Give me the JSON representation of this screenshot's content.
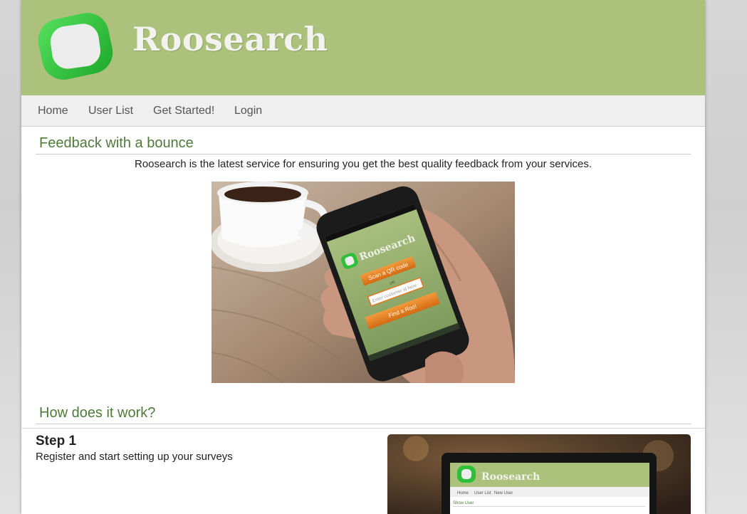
{
  "brand": {
    "name": "Roosearch"
  },
  "nav": [
    {
      "label": "Home"
    },
    {
      "label": "User List"
    },
    {
      "label": "Get Started!"
    },
    {
      "label": "Login"
    }
  ],
  "hero": {
    "title": "Feedback with a bounce",
    "intro": "Roosearch is the latest service for ensuring you get the best quality feedback from your services.",
    "phone": {
      "app_name": "Roosearch",
      "scan_button": "Scan a QR code",
      "or_text": "OR",
      "input_placeholder": "Enter customer id here",
      "find_button": "Find a Roo!"
    }
  },
  "how": {
    "title": "How does it work?",
    "steps": [
      {
        "title": "Step 1",
        "text": "Register and start setting up your surveys",
        "laptop": {
          "app_name": "Roosearch",
          "nav": [
            "Home",
            "User List",
            "New User"
          ],
          "subheading": "Show User"
        }
      }
    ]
  },
  "colors": {
    "header_bg": "#abc17c",
    "accent_green": "#4e7a3a",
    "logo_green": "#2fbf3a",
    "button_orange": "#e07a1f"
  }
}
